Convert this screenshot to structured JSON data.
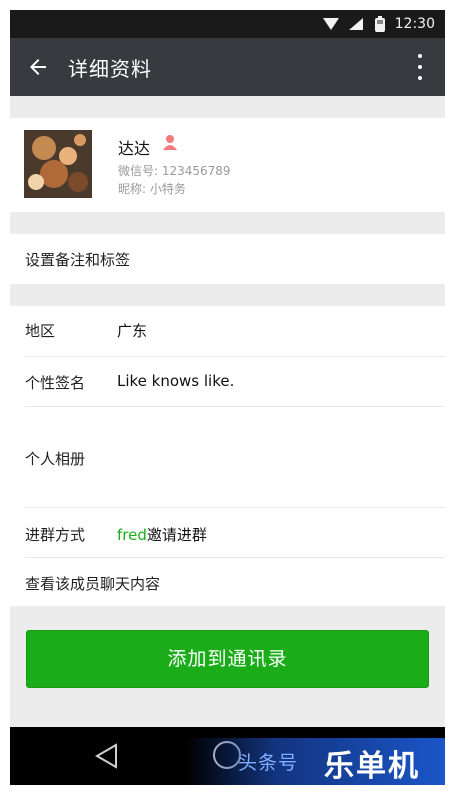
{
  "status_bar": {
    "time": "12:30"
  },
  "app_bar": {
    "title": "详细资料"
  },
  "profile": {
    "name": "达达",
    "wechat_id": "微信号: 123456789",
    "nickname": "昵称: 小特务"
  },
  "remark_row": {
    "label": "设置备注和标签"
  },
  "info_rows": [
    {
      "label": "地区",
      "value": "广东"
    },
    {
      "label": "个性签名",
      "value": "Like knows like."
    },
    {
      "label": "个人相册"
    },
    {
      "label": "进群方式",
      "value_highlight": "fred",
      "value_rest": "邀请进群"
    },
    {
      "label": "查看该成员聊天内容"
    }
  ],
  "add_button": {
    "label": "添加到通讯录"
  },
  "watermark": {
    "small": "头条号",
    "big": "乐单机"
  },
  "colors": {
    "accent": "#1aad19",
    "app_bar": "#393a3f",
    "page_bg": "#ececec"
  }
}
